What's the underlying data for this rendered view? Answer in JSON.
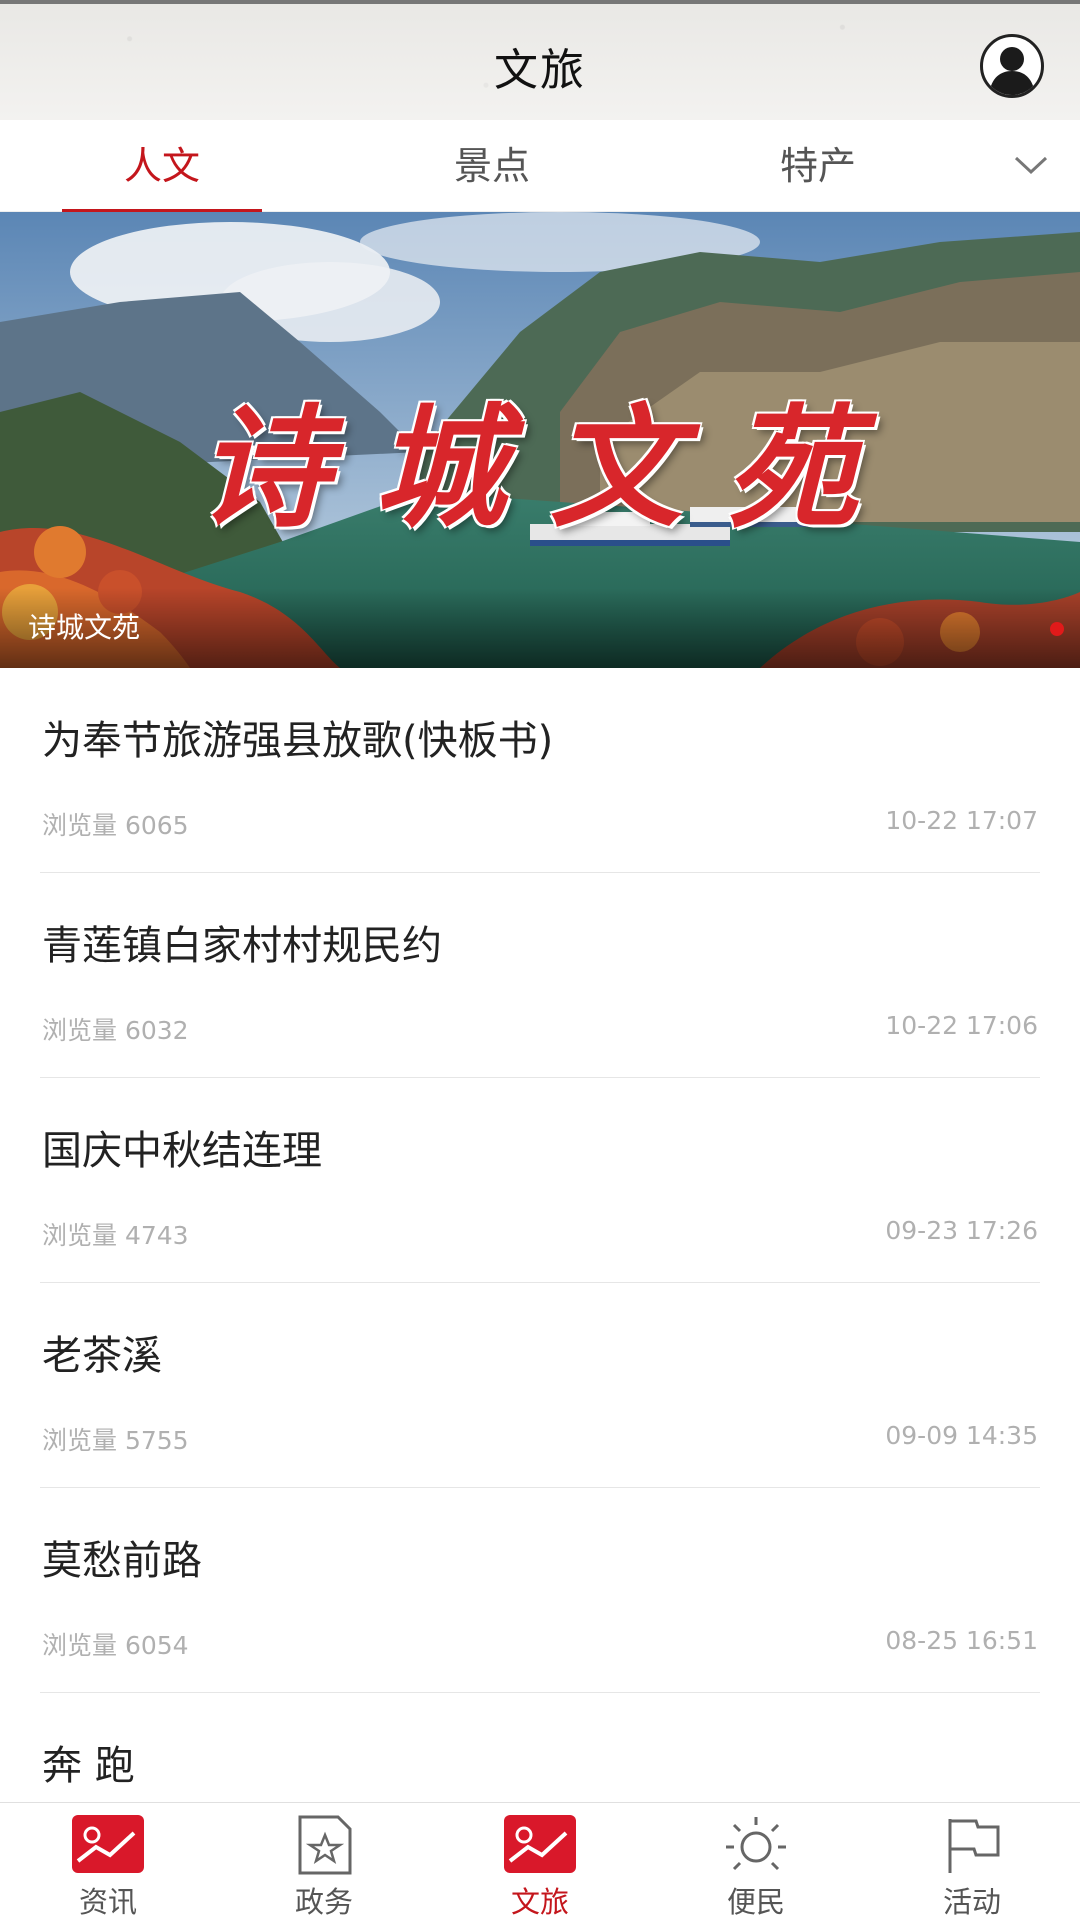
{
  "header": {
    "title": "文旅",
    "avatar_icon": "user-avatar-icon"
  },
  "tabs": [
    {
      "label": "人文",
      "active": true
    },
    {
      "label": "景点",
      "active": false
    },
    {
      "label": "特产",
      "active": false
    }
  ],
  "tabs_more_icon": "chevron-down-icon",
  "banner": {
    "art_text": "诗城文苑",
    "caption": "诗城文苑",
    "slide_count": 1,
    "active_slide": 1
  },
  "articles": [
    {
      "title": "为奉节旅游强县放歌(快板书)",
      "views": "浏览量 6065",
      "time": "10-22 17:07"
    },
    {
      "title": "青莲镇白家村村规民约",
      "views": "浏览量 6032",
      "time": "10-22 17:06"
    },
    {
      "title": "国庆中秋结连理",
      "views": "浏览量 4743",
      "time": "09-23 17:26"
    },
    {
      "title": "老茶溪",
      "views": "浏览量 5755",
      "time": "09-09 14:35"
    },
    {
      "title": "莫愁前路",
      "views": "浏览量 6054",
      "time": "08-25 16:51"
    },
    {
      "title": "奔 跑",
      "views": "",
      "time": ""
    }
  ],
  "bottom_nav": [
    {
      "label": "资讯",
      "icon": "news-icon",
      "active": false
    },
    {
      "label": "政务",
      "icon": "government-icon",
      "active": false
    },
    {
      "label": "文旅",
      "icon": "culture-travel-icon",
      "active": true
    },
    {
      "label": "便民",
      "icon": "sun-icon",
      "active": false
    },
    {
      "label": "活动",
      "icon": "flag-icon",
      "active": false
    }
  ],
  "colors": {
    "accent": "#c4161c",
    "muted": "#b0b0b0"
  }
}
